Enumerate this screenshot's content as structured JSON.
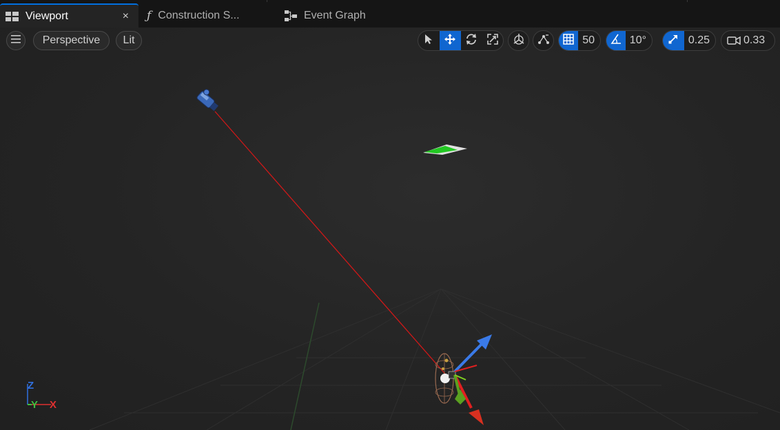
{
  "tabs": [
    {
      "label": "Viewport",
      "icon": "viewport-layout-icon",
      "active": true,
      "close": "×"
    },
    {
      "label": "Construction S...",
      "icon": "function-icon",
      "active": false
    },
    {
      "label": "Event Graph",
      "icon": "graph-icon",
      "active": false
    }
  ],
  "viewport_toolbar": {
    "menu_icon": "hamburger-menu-icon",
    "view_mode": "Perspective",
    "lighting_mode": "Lit",
    "transform_tools": [
      "select-icon",
      "translate-icon",
      "rotate-icon",
      "scale-icon"
    ],
    "active_tool": "translate",
    "coordinate_space_icon": "world-space-icon",
    "surface_snap_icon": "surface-snap-icon",
    "grid_snap": {
      "icon": "grid-icon",
      "value": "50",
      "enabled": true
    },
    "rotation_snap": {
      "icon": "angle-icon",
      "value": "10°",
      "enabled": true
    },
    "scale_snap": {
      "icon": "scale-arrow-icon",
      "value": "0.25",
      "enabled": true
    },
    "camera_speed": {
      "icon": "camera-icon",
      "value": "0.33"
    }
  },
  "axis_indicator": {
    "z": "Z",
    "y": "Y",
    "x": "X"
  },
  "colors": {
    "accent": "#1066d0",
    "axis_x": "#e03030",
    "axis_y": "#40c040",
    "axis_z": "#3070e0",
    "trace_line": "#d01818"
  }
}
